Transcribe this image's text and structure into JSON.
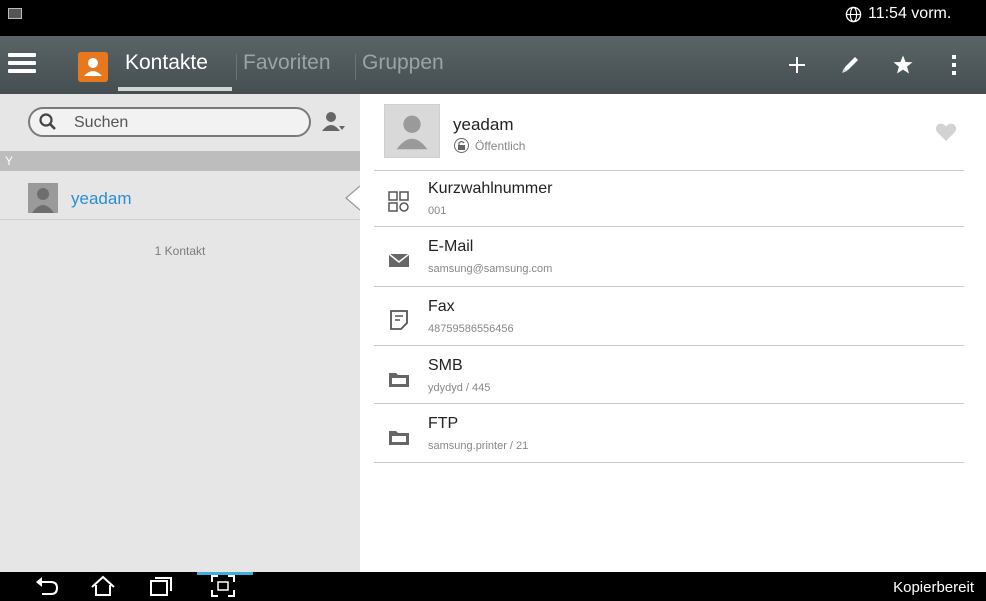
{
  "status": {
    "time": "11:54 vorm.",
    "notification_icon": "image-notification-icon",
    "network_icon": "globe-icon"
  },
  "actionbar": {
    "tabs": [
      {
        "label": "Kontakte",
        "active": true
      },
      {
        "label": "Favoriten",
        "active": false
      },
      {
        "label": "Gruppen",
        "active": false
      }
    ],
    "actions": [
      "add-icon",
      "edit-icon",
      "star-icon",
      "overflow-menu-icon"
    ]
  },
  "list": {
    "search_placeholder": "Suchen",
    "section_letter": "Y",
    "contacts": [
      {
        "name": "yeadam"
      }
    ],
    "count_label": "1 Kontakt"
  },
  "detail": {
    "name": "yeadam",
    "visibility": "Öffentlich",
    "fields": [
      {
        "label": "Kurzwahlnummer",
        "value": "001",
        "icon": "speed-dial-icon"
      },
      {
        "label": "E-Mail",
        "value": "samsung@samsung.com",
        "icon": "mail-icon"
      },
      {
        "label": "Fax",
        "value": "48759586556456",
        "icon": "fax-icon"
      },
      {
        "label": "SMB",
        "value": "ydydyd / 445",
        "icon": "smb-folder-icon"
      },
      {
        "label": "FTP",
        "value": "samsung.printer / 21",
        "icon": "ftp-folder-icon"
      }
    ]
  },
  "navbar": {
    "status_text": "Kopierbereit"
  },
  "colors": {
    "accent_blue": "#2a8ed0",
    "actionbar": "#4f585b",
    "app_orange": "#e8781e"
  }
}
